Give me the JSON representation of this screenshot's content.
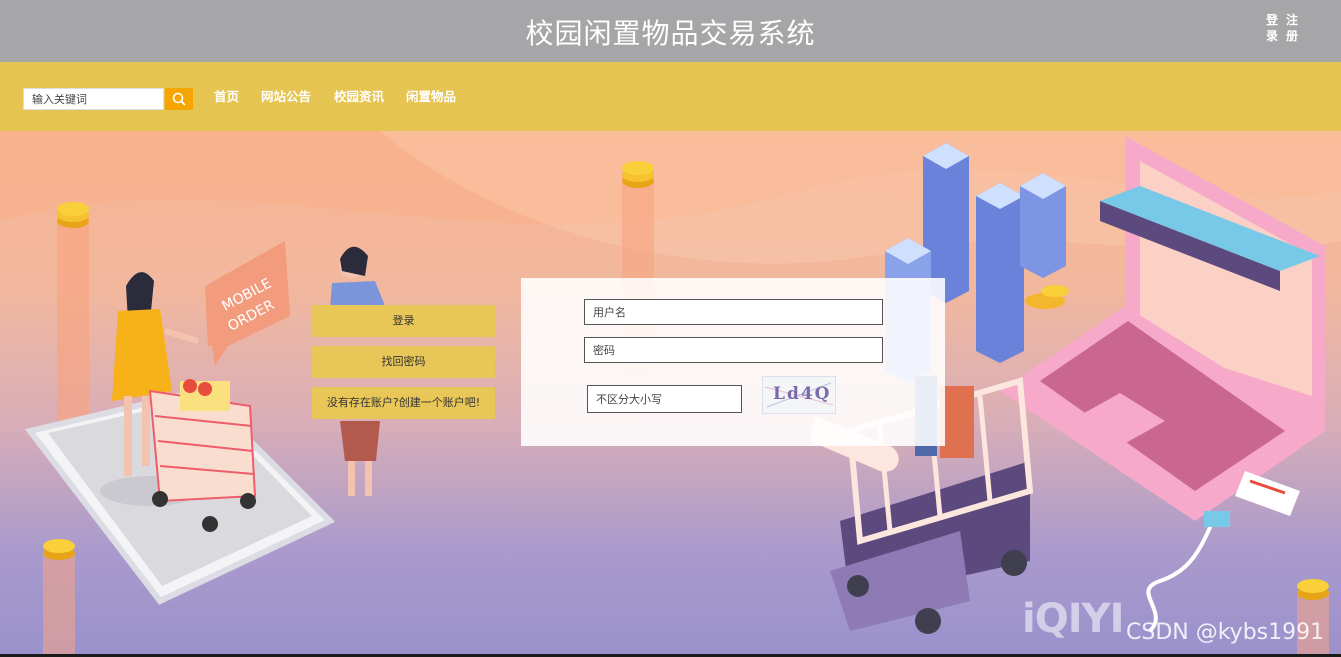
{
  "header": {
    "title": "校园闲置物品交易系统",
    "auth_links": [
      "登录",
      "注册"
    ]
  },
  "nav": {
    "search_placeholder": "输入关键词",
    "items": [
      "首页",
      "网站公告",
      "校园资讯",
      "闲置物品"
    ]
  },
  "sidebar_buttons": {
    "login": "登录",
    "recover": "找回密码",
    "register": "没有存在账户?创建一个账户吧!"
  },
  "login_form": {
    "username_placeholder": "用户名",
    "password_placeholder": "密码",
    "captcha_placeholder": "不区分大小写",
    "captcha_text": "Ld4Q"
  },
  "illustration": {
    "phone_sign": "MOBILE ORDER"
  },
  "watermark": {
    "logo": "iQIYI",
    "text": "CSDN @kybs1991"
  },
  "colors": {
    "header_bg": "#a6a6a8",
    "nav_bg": "#e5c452",
    "search_button": "#f5a400",
    "button_bg": "#e8c657"
  }
}
